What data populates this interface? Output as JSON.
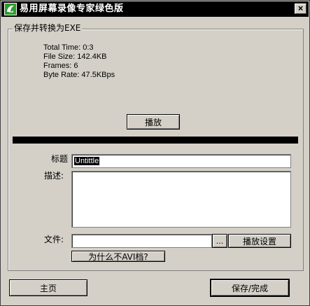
{
  "window": {
    "title": "易用屏幕录像专家绿色版",
    "close_label": "×",
    "icon": "app-logo-icon"
  },
  "group": {
    "legend": "保存并转换为EXE"
  },
  "info": {
    "total_time": "Total Time: 0:3",
    "file_size": "File Size: 142.4KB",
    "frames": "Frames: 6",
    "byte_rate": "Byte Rate: 47.5KBps"
  },
  "buttons": {
    "play": "播放",
    "browse": "...",
    "play_settings": "播放设置",
    "why_not_avi": "为什么不AVI档?",
    "home": "主页",
    "save_finish": "保存/完成"
  },
  "form": {
    "title_label": "标题",
    "title_value": "Untittle",
    "desc_label": "描述:",
    "desc_value": "",
    "file_label": "文件:",
    "file_value": ""
  },
  "colors": {
    "face": "#d4d0c8",
    "titlebar": "#000000",
    "divider": "#000000",
    "icon_green": "#2e9b2e"
  }
}
